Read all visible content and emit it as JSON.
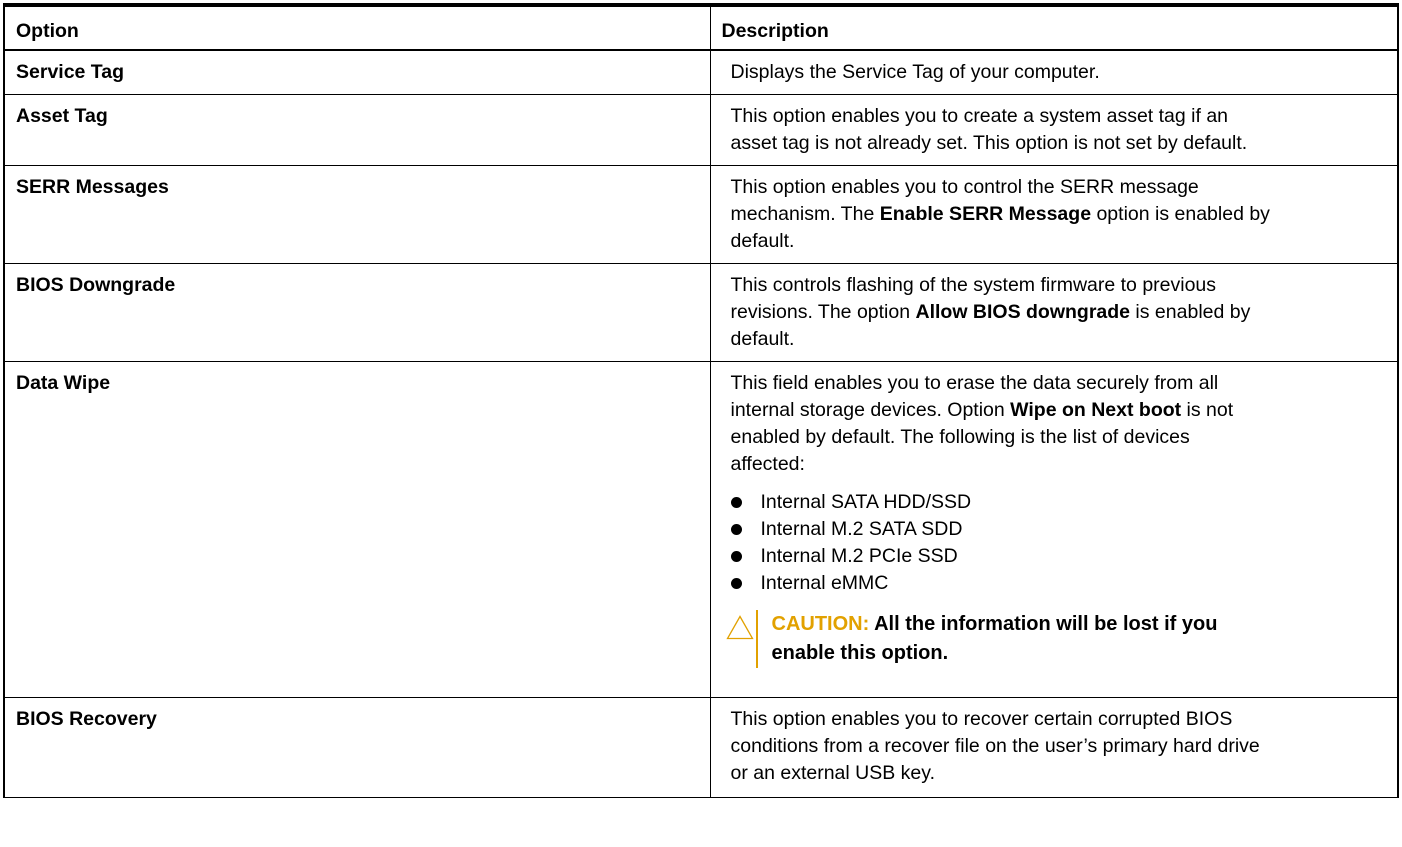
{
  "table": {
    "headers": {
      "option": "Option",
      "description": "Description"
    },
    "rows": [
      {
        "option": "Service Tag",
        "description": [
          "Displays the Service Tag of your computer."
        ]
      },
      {
        "option": "Asset Tag",
        "description": [
          "This option enables you to create a system asset tag if an",
          "asset tag is not already set. This option is not set by default."
        ]
      },
      {
        "option": "SERR Messages",
        "description_lines": {
          "l1": "This option enables you to control the SERR message",
          "l2_pre": "mechanism. The ",
          "l2_bold": "Enable SERR Message",
          "l2_post": " option is enabled by",
          "l3": "default."
        }
      },
      {
        "option": "BIOS Downgrade",
        "description_lines": {
          "l1": "This controls flashing of the system firmware to previous",
          "l2_pre": "revisions. The option ",
          "l2_bold": "Allow BIOS downgrade",
          "l2_post": " is enabled by",
          "l3": "default."
        }
      },
      {
        "option": "Data Wipe",
        "description_lines": {
          "l1": "This field enables you to erase the data securely from all",
          "l2_pre": "internal storage devices. Option ",
          "l2_bold": "Wipe on Next boot",
          "l2_post": " is not",
          "l3": "enabled by default. The following is the list of devices",
          "l4": "affected:"
        },
        "devices": [
          "Internal SATA HDD/SSD",
          "Internal M.2 SATA SDD",
          "Internal M.2 PCIe SSD",
          "Internal eMMC"
        ],
        "caution": {
          "label": "CAUTION:",
          "text_l1": " All the information will be lost if you",
          "text_l2": "enable this option."
        }
      },
      {
        "option": "BIOS Recovery",
        "description": [
          "This option enables you to recover certain corrupted BIOS",
          "conditions from a recover file on the user’s primary hard drive",
          "or an external USB key."
        ]
      }
    ]
  },
  "icons": {
    "caution": "warning-triangle-icon",
    "bullet": "bullet-dot-icon"
  },
  "colors": {
    "caution": "#e2a100",
    "border": "#000000"
  }
}
